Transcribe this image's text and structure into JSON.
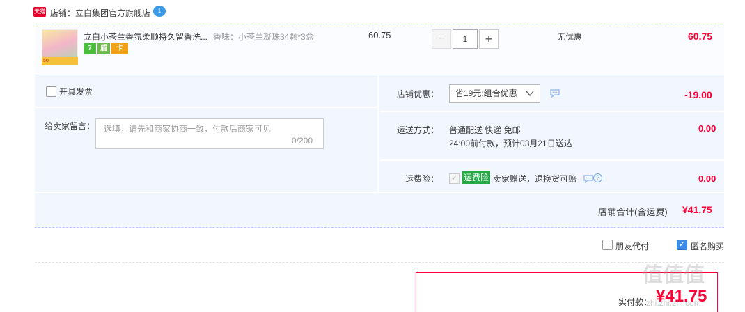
{
  "shop": {
    "badge": "天猫",
    "name": "店铺：立白集团官方旗舰店",
    "chat_badge": "1"
  },
  "item": {
    "title": "立白小苍兰香氛柔顺持久留香洗...",
    "sku": "香味：小苍兰凝珠34颗*3盒",
    "thumb_tag": "50",
    "badges": [
      "7",
      "盾",
      "卡"
    ],
    "unit_price": "60.75",
    "quantity": "1",
    "minus": "−",
    "plus": "+",
    "discount": "无优惠",
    "total": "60.75"
  },
  "invoice": {
    "label": "开具发票"
  },
  "memo": {
    "label": "给卖家留言：",
    "placeholder": "选填，请先和商家协商一致，付款后商家可见",
    "count": "0/200"
  },
  "shop_discount": {
    "label": "店铺优惠：",
    "selected": "省19元:组合优惠",
    "amount": "-19.00"
  },
  "shipping": {
    "label": "运送方式：",
    "method": "普通配送 快递 免邮",
    "eta": "24:00前付款，预计03月21日送达",
    "amount": "0.00"
  },
  "insurance": {
    "label": "运费险：",
    "check": "✓",
    "tag": "运费险",
    "text": "卖家赠送，退换货可赔",
    "help": "?",
    "amount": "0.00"
  },
  "subtotal": {
    "label": "店铺合计(含运费)",
    "amount": "¥41.75"
  },
  "options": {
    "friend_pay": "朋友代付",
    "anonymous": "匿名购买",
    "anonymous_check": "✓"
  },
  "payment": {
    "label": "实付款：",
    "amount": "¥41.75"
  },
  "watermark": {
    "logo": "值值值",
    "site": "zhi.zhi.zhi.com"
  },
  "colors": {
    "accent": "#ff0036",
    "panel": "#f2f7ff",
    "checkbox_checked": "#3b8de8"
  },
  "icons": [
    "tmall-logo-icon",
    "wangwang-chat-icon",
    "chevron-down-icon",
    "chat-bubble-icon",
    "help-icon",
    "checkbox-checked-icon"
  ]
}
